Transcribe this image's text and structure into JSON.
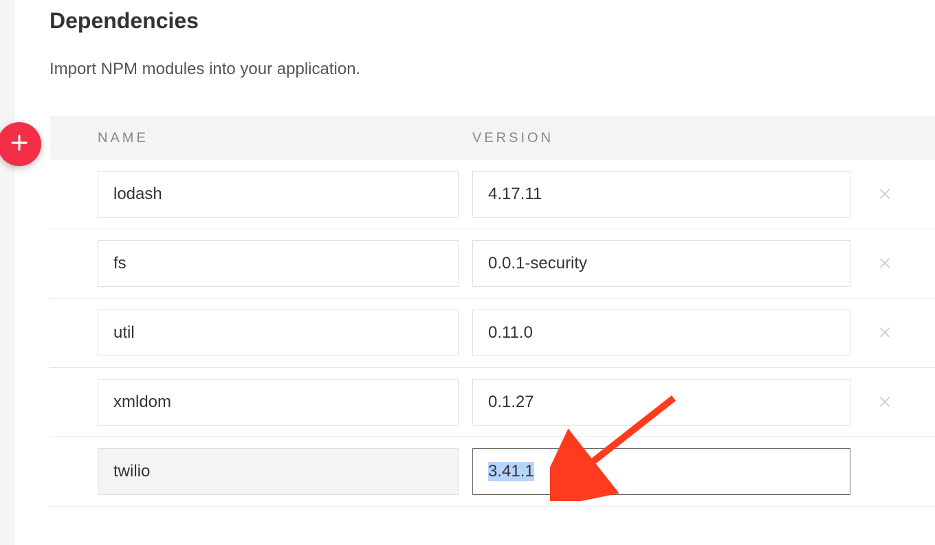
{
  "section": {
    "title": "Dependencies",
    "description": "Import NPM modules into your application."
  },
  "table": {
    "headers": {
      "name": "NAME",
      "version": "VERSION"
    },
    "rows": [
      {
        "name": "lodash",
        "version": "4.17.11",
        "deletable": true,
        "name_readonly": false,
        "version_selected": false,
        "version_focused": false
      },
      {
        "name": "fs",
        "version": "0.0.1-security",
        "deletable": true,
        "name_readonly": false,
        "version_selected": false,
        "version_focused": false
      },
      {
        "name": "util",
        "version": "0.11.0",
        "deletable": true,
        "name_readonly": false,
        "version_selected": false,
        "version_focused": false
      },
      {
        "name": "xmldom",
        "version": "0.1.27",
        "deletable": true,
        "name_readonly": false,
        "version_selected": false,
        "version_focused": false
      },
      {
        "name": "twilio",
        "version": "3.41.1",
        "deletable": false,
        "name_readonly": true,
        "version_selected": true,
        "version_focused": true
      }
    ]
  },
  "colors": {
    "accent": "#F22F46",
    "arrow": "#FF3B1F"
  }
}
